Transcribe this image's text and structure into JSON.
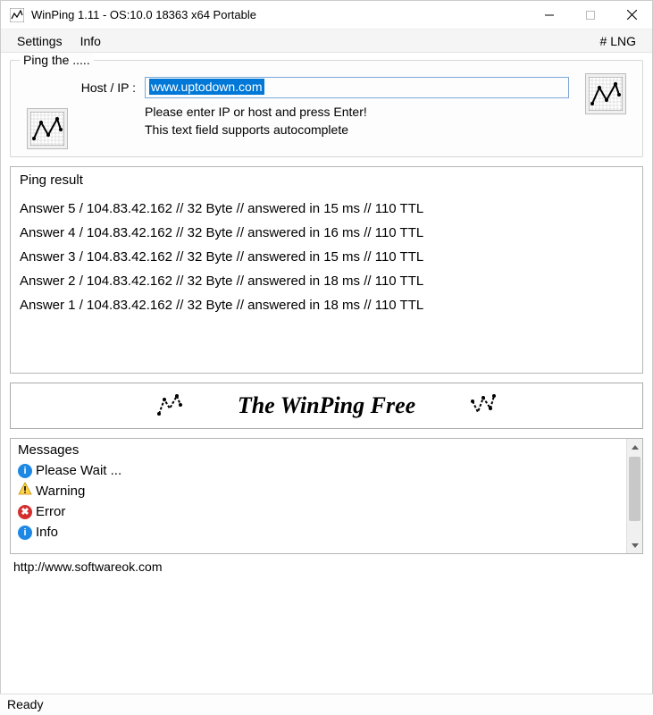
{
  "window": {
    "title": "WinPing 1.11 - OS:10.0 18363 x64 Portable"
  },
  "menu": {
    "settings": "Settings",
    "info": "Info",
    "lng": "# LNG"
  },
  "ping_section": {
    "group_title": "Ping the .....",
    "host_label": "Host / IP :",
    "host_value": "www.uptodown.com",
    "hint1": "Please enter IP or host and press Enter!",
    "hint2": "This text field supports autocomplete"
  },
  "results": {
    "title": "Ping result",
    "lines": [
      "Answer  5 / 104.83.42.162  // 32 Byte // answered in 15 ms // 110 TTL",
      "Answer  4 / 104.83.42.162  // 32 Byte // answered in 16 ms // 110 TTL",
      "Answer  3 / 104.83.42.162  // 32 Byte // answered in 15 ms // 110 TTL",
      "Answer  2 / 104.83.42.162  // 32 Byte // answered in 18 ms // 110 TTL",
      "Answer  1 / 104.83.42.162  // 32 Byte // answered in 18 ms // 110 TTL"
    ]
  },
  "banner": {
    "text": "The WinPing Free"
  },
  "messages": {
    "title": "Messages",
    "items": [
      {
        "type": "info",
        "text": "Please Wait ..."
      },
      {
        "type": "warn",
        "text": "Warning"
      },
      {
        "type": "err",
        "text": "Error"
      },
      {
        "type": "info",
        "text": "Info"
      }
    ]
  },
  "footer": {
    "url": "http://www.softwareok.com"
  },
  "status": {
    "text": "Ready"
  }
}
